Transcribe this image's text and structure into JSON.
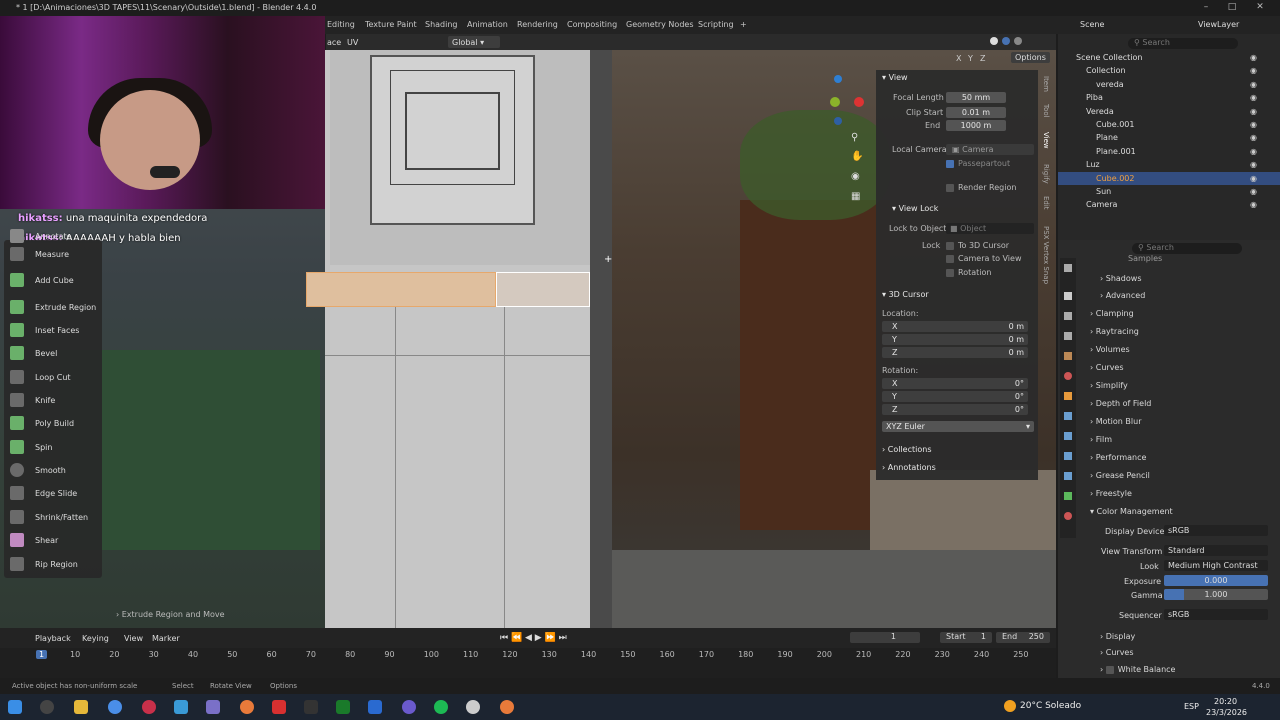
{
  "window": {
    "title": "* 1 [D:\\Animaciones\\3D TAPES\\11\\Scenary\\Outside\\1.blend] - Blender 4.4.0"
  },
  "workspaces": [
    "Editing",
    "Texture Paint",
    "Shading",
    "Animation",
    "Rendering",
    "Compositing",
    "Geometry Nodes",
    "Scripting"
  ],
  "viewport_header": {
    "mode_tail": "ace",
    "uv": "UV",
    "orientation": "Global",
    "options": "Options",
    "axes": [
      "X",
      "Y",
      "Z"
    ]
  },
  "chat": [
    {
      "user": "hikatss:",
      "msg": " una maquinita expendedora"
    },
    {
      "user": "hikatss:",
      "msg": " AAAAAAH y habla bien"
    }
  ],
  "tools": [
    "Annotate",
    "Measure",
    "Add Cube",
    "Extrude Region",
    "Inset Faces",
    "Bevel",
    "Loop Cut",
    "Knife",
    "Poly Build",
    "Spin",
    "Smooth",
    "Edge Slide",
    "Shrink/Fatten",
    "Shear",
    "Rip Region"
  ],
  "last_operator": "Extrude Region and Move",
  "npanel": {
    "tabs": [
      "Item",
      "Tool",
      "View",
      "Rigify",
      "Edit",
      "PSX Vertex Snap"
    ],
    "view_title": "View",
    "focal_label": "Focal Length",
    "focal": "50 mm",
    "clip_start_label": "Clip Start",
    "clip_start": "0.01 m",
    "end_label": "End",
    "end": "1000 m",
    "local_camera_label": "Local Camera",
    "camera": "Camera",
    "passepartout": "Passepartout",
    "render_region": "Render Region",
    "view_lock_title": "View Lock",
    "lock_obj_label": "Lock to Object",
    "object_ph": "Object",
    "lock_label": "Lock",
    "to_cursor": "To 3D Cursor",
    "cam_to_view": "Camera to View",
    "rotation": "Rotation",
    "cursor_title": "3D Cursor",
    "location_label": "Location:",
    "lx": "X",
    "ly": "Y",
    "lz": "Z",
    "lxv": "0 m",
    "lyv": "0 m",
    "lzv": "0 m",
    "rotation_label": "Rotation:",
    "rxv": "0°",
    "ryv": "0°",
    "rzv": "0°",
    "euler": "XYZ Euler",
    "collections": "Collections",
    "annotations": "Annotations"
  },
  "outliner": {
    "scene": "Scene",
    "view_layer": "ViewLayer",
    "search_ph": "Search",
    "rows": [
      {
        "label": "Scene Collection",
        "indent": 0
      },
      {
        "label": "Collection",
        "indent": 1
      },
      {
        "label": "vereda",
        "indent": 2
      },
      {
        "label": "Piba",
        "indent": 1
      },
      {
        "label": "Vereda",
        "indent": 1
      },
      {
        "label": "Cube.001",
        "indent": 2
      },
      {
        "label": "Plane",
        "indent": 2
      },
      {
        "label": "Plane.001",
        "indent": 2
      },
      {
        "label": "Luz",
        "indent": 1
      },
      {
        "label": "Cube.002",
        "indent": 2,
        "selected": true
      },
      {
        "label": "Sun",
        "indent": 2
      },
      {
        "label": "Camera",
        "indent": 1
      }
    ]
  },
  "properties": {
    "search_ph": "Search",
    "samples": "Samples",
    "sections": [
      "Shadows",
      "Advanced",
      "Clamping",
      "Raytracing",
      "Volumes",
      "Curves",
      "Simplify",
      "Depth of Field",
      "Motion Blur",
      "Film",
      "Performance",
      "Grease Pencil",
      "Freestyle",
      "Color Management"
    ],
    "display_device_label": "Display Device",
    "display_device": "sRGB",
    "view_transform_label": "View Transform",
    "view_transform": "Standard",
    "look_label": "Look",
    "look": "Medium High Contrast",
    "exposure_label": "Exposure",
    "exposure": "0.000",
    "gamma_label": "Gamma",
    "gamma": "1.000",
    "sequencer_label": "Sequencer",
    "sequencer": "sRGB",
    "tail": [
      "Display",
      "Curves",
      "White Balance"
    ]
  },
  "timeline": {
    "menus": [
      "Playback",
      "Keying",
      "View",
      "Marker"
    ],
    "current_frame": "1",
    "start_label": "Start",
    "start": "1",
    "end_label": "End",
    "end": "250",
    "ticks": [
      "1",
      "10",
      "20",
      "30",
      "40",
      "50",
      "60",
      "70",
      "80",
      "90",
      "100",
      "110",
      "120",
      "130",
      "140",
      "150",
      "160",
      "170",
      "180",
      "190",
      "200",
      "210",
      "220",
      "230",
      "240",
      "250"
    ]
  },
  "status": {
    "warning": "Active object has non-uniform scale",
    "select": "Select",
    "rotate": "Rotate View",
    "options": "Options",
    "version": "4.4.0"
  },
  "taskbar": {
    "weather": "20°C  Soleado",
    "lang": "ESP",
    "time": "20:20",
    "date": "23/3/2026"
  }
}
